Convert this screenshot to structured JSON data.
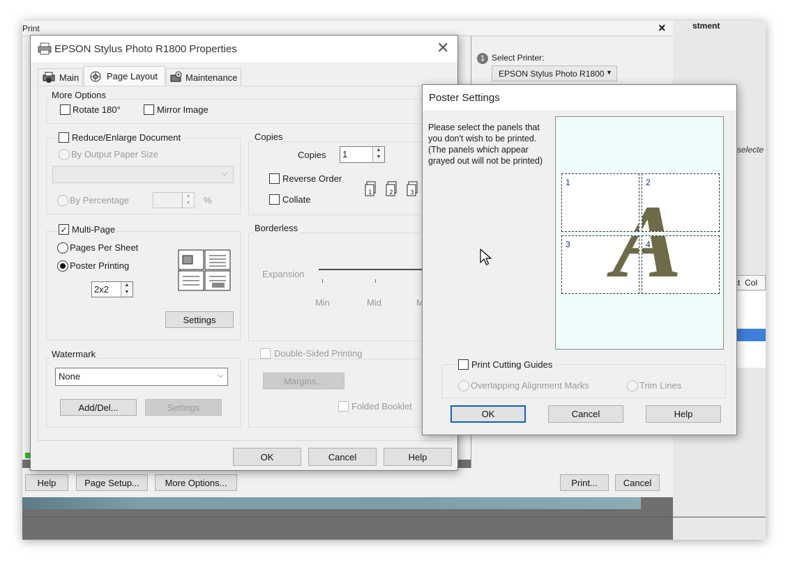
{
  "print_dialog": {
    "title": "Print",
    "adjustment_label": "stment",
    "select_printer_step": "1",
    "select_printer_label": "Select Printer:",
    "printer_value": "EPSON Stylus Photo R1800",
    "cropped_text": "selecte",
    "col_cropped_1": "st",
    "col_cropped_2": "Col",
    "help_label": "Help",
    "page_setup_label": "Page Setup...",
    "more_options_label": "More Options...",
    "print_label": "Print...",
    "cancel_label": "Cancel"
  },
  "properties": {
    "title": "EPSON Stylus Photo R1800 Properties",
    "tabs": [
      {
        "label": "Main",
        "icon": "printer-tab-icon"
      },
      {
        "label": "Page Layout",
        "icon": "page-layout-icon"
      },
      {
        "label": "Maintenance",
        "icon": "maintenance-icon"
      }
    ],
    "more_options": {
      "title": "More Options",
      "rotate_label": "Rotate 180°",
      "mirror_label": "Mirror Image"
    },
    "reduce": {
      "label": "Reduce/Enlarge Document",
      "by_output_label": "By Output Paper Size",
      "by_percentage_label": "By Percentage",
      "percent_symbol": "%"
    },
    "copies": {
      "title": "Copies",
      "copies_label": "Copies",
      "copies_value": "1",
      "reverse_label": "Reverse Order",
      "collate_label": "Collate"
    },
    "multipage": {
      "label": "Multi-Page",
      "pages_per_sheet_label": "Pages Per Sheet",
      "poster_label": "Poster Printing",
      "poster_value": "2x2",
      "settings_label": "Settings"
    },
    "borderless": {
      "title": "Borderless",
      "expansion_label": "Expansion",
      "min_label": "Min",
      "mid_label": "Mid",
      "max_label": "M"
    },
    "watermark": {
      "title": "Watermark",
      "value": "None",
      "add_del_label": "Add/Del...",
      "settings_label": "Settings"
    },
    "double_sided": {
      "label": "Double-Sided Printing",
      "margins_label": "Margins...",
      "folded_label": "Folded Booklet"
    },
    "ok_label": "OK",
    "cancel_label": "Cancel",
    "help_label": "Help"
  },
  "poster": {
    "title": "Poster Settings",
    "instructions": "Please select the panels that you don't wish to be printed. (The panels which appear grayed out will not be printed)",
    "panels": [
      "1",
      "2",
      "3",
      "4"
    ],
    "cutting_guides_label": "Print Cutting Guides",
    "overlapping_label": "Overlapping Alignment Marks",
    "trim_label": "Trim Lines",
    "ok_label": "OK",
    "cancel_label": "Cancel",
    "help_label": "Help",
    "letter": "A"
  }
}
